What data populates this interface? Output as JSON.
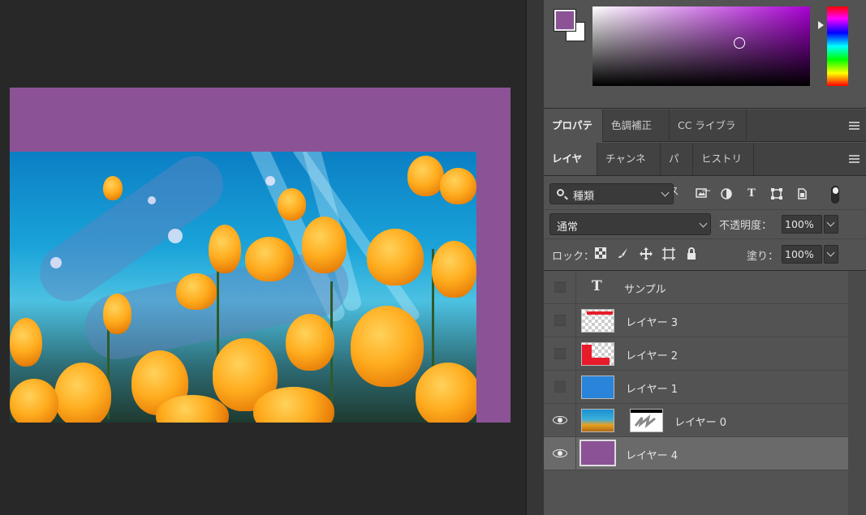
{
  "colors": {
    "foreground": "#8b5396",
    "background": "#ffffff",
    "document_bg": "#8b5396",
    "panel": "#535353"
  },
  "properties_tabs": [
    {
      "label": "プロパティ",
      "active": true
    },
    {
      "label": "色調補正",
      "active": false
    },
    {
      "label": "CC ライブラリ",
      "active": false
    }
  ],
  "layers_tabs": [
    {
      "label": "レイヤー",
      "active": true
    },
    {
      "label": "チャンネル",
      "active": false
    },
    {
      "label": "パス",
      "active": false
    },
    {
      "label": "ヒストリー",
      "active": false
    }
  ],
  "filter": {
    "kind_value": "種類",
    "icons": [
      "image-filter-icon",
      "adjustment-filter-icon",
      "type-filter-icon",
      "shape-filter-icon",
      "smart-object-filter-icon"
    ]
  },
  "blend": {
    "mode": "通常",
    "opacity_label": "不透明度：",
    "opacity_value": "100%"
  },
  "lock": {
    "label": "ロック：",
    "fill_label": "塗り：",
    "fill_value": "100%"
  },
  "layers": [
    {
      "name": "サンプル",
      "type": "text",
      "visible": false
    },
    {
      "name": "レイヤー 3",
      "type": "pixel",
      "visible": false
    },
    {
      "name": "レイヤー 2",
      "type": "pixel",
      "visible": false
    },
    {
      "name": "レイヤー 1",
      "type": "pixel",
      "visible": false
    },
    {
      "name": "レイヤー 0",
      "type": "masked",
      "visible": true
    },
    {
      "name": "レイヤー 4",
      "type": "pixel",
      "visible": true,
      "selected": true
    }
  ]
}
